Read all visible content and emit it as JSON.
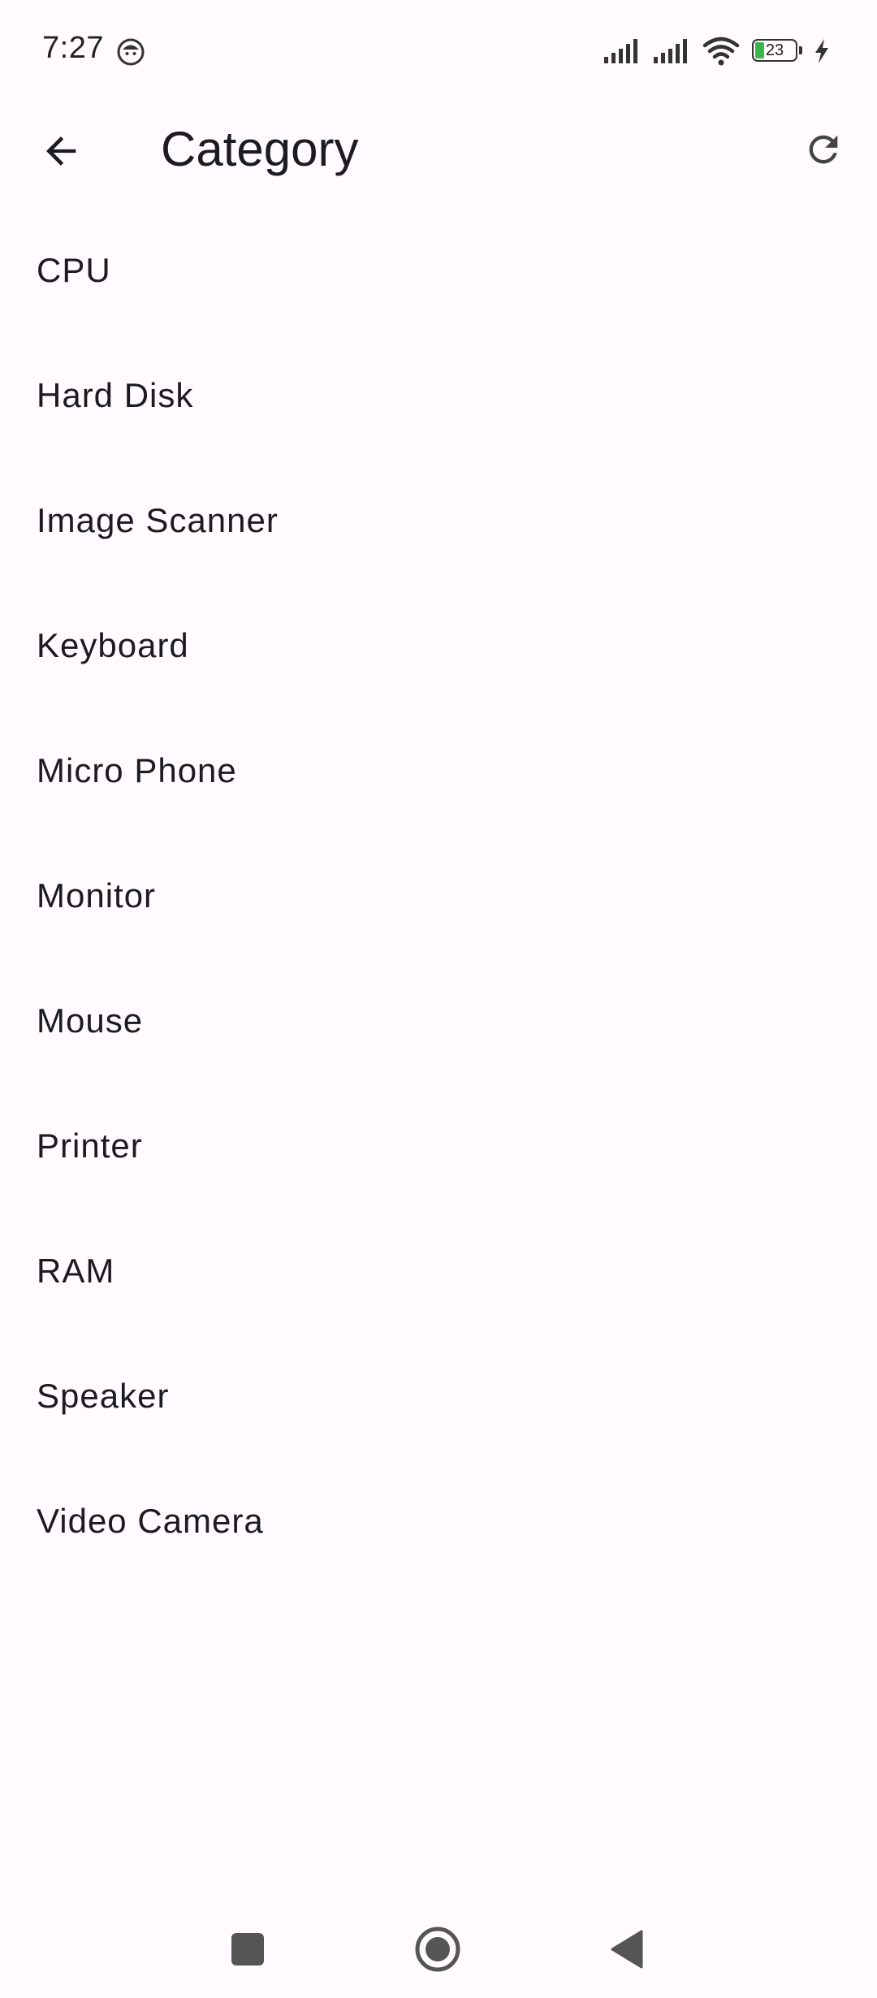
{
  "status_bar": {
    "time": "7:27",
    "battery_level": "23",
    "battery_color": "#39b54a",
    "icons": [
      "notification-face-icon",
      "signal-icon",
      "signal-icon",
      "wifi-icon",
      "battery-icon",
      "charging-icon"
    ]
  },
  "app_bar": {
    "title": "Category",
    "back_icon": "arrow-back-icon",
    "refresh_icon": "refresh-icon"
  },
  "categories": [
    "CPU",
    "Hard Disk",
    "Image Scanner",
    "Keyboard",
    "Micro Phone",
    "Monitor",
    "Mouse",
    "Printer",
    "RAM",
    "Speaker",
    "Video Camera"
  ],
  "nav_bar": {
    "icons": [
      "recents-square-icon",
      "home-circle-icon",
      "back-triangle-icon"
    ]
  },
  "colors": {
    "background": "#fffbfe",
    "text": "#1c1b1f"
  }
}
